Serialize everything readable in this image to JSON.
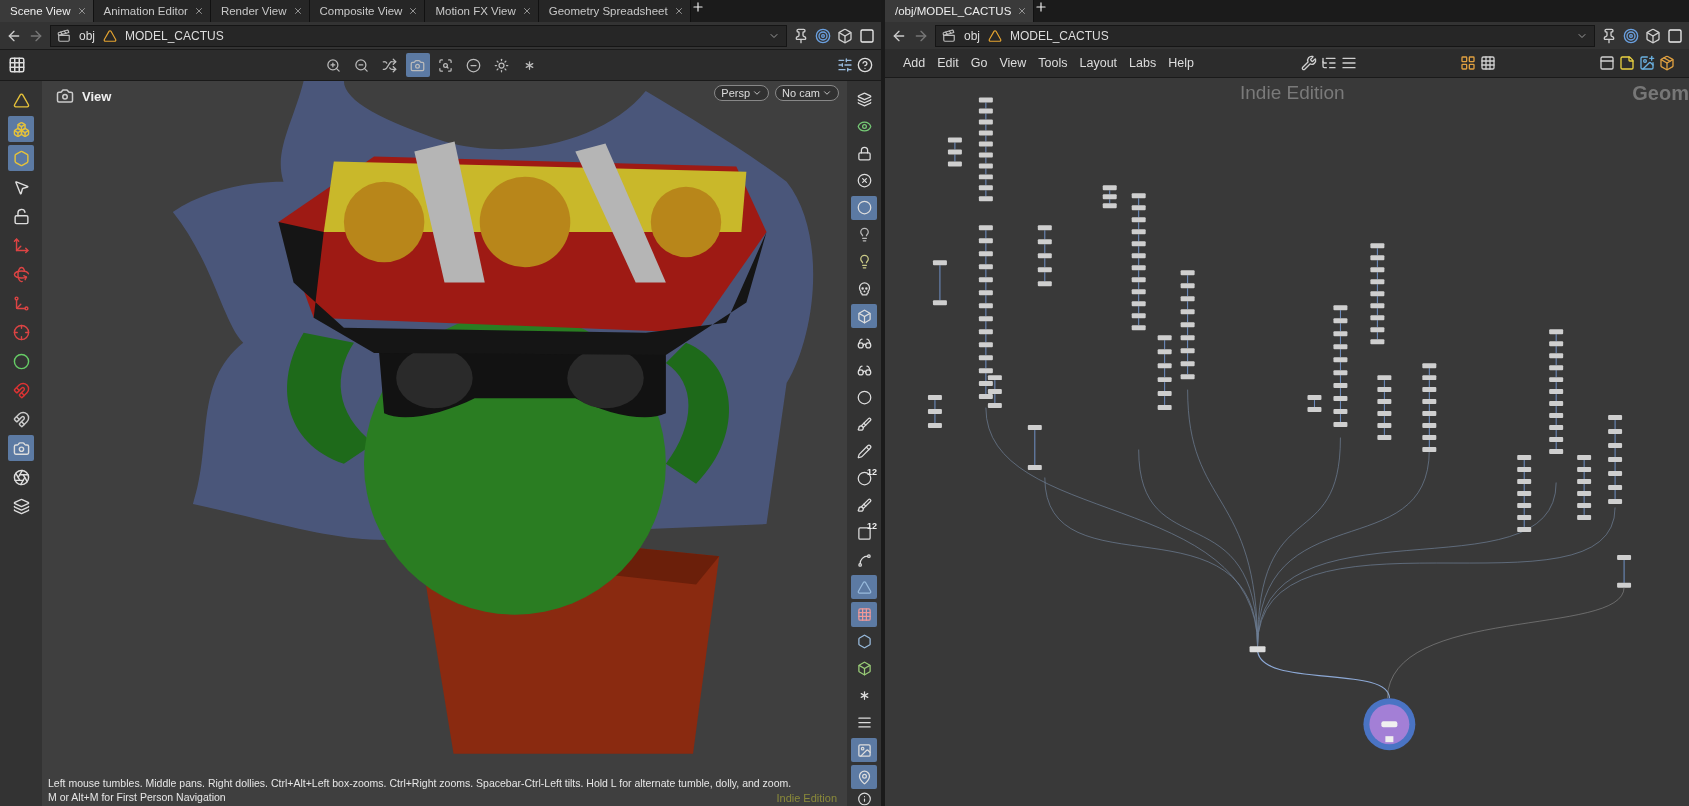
{
  "left_pane": {
    "tabs": [
      {
        "label": "Scene View",
        "selected": true
      },
      {
        "label": "Animation Editor",
        "selected": false
      },
      {
        "label": "Render View",
        "selected": false
      },
      {
        "label": "Composite View",
        "selected": false
      },
      {
        "label": "Motion FX View",
        "selected": false
      },
      {
        "label": "Geometry Spreadsheet",
        "selected": false
      }
    ],
    "path": [
      "obj",
      "MODEL_CACTUS"
    ],
    "view_tools": [
      {
        "selected": false
      },
      {
        "selected": false
      },
      {
        "selected": false
      },
      {
        "selected": true
      },
      {
        "selected": false
      },
      {
        "selected": false
      },
      {
        "selected": false
      },
      {
        "selected": false
      }
    ],
    "left_tools": [
      {
        "selected": false
      },
      {
        "selected": true
      },
      {
        "selected": true
      },
      {
        "selected": false
      },
      {
        "selected": false
      },
      {
        "selected": false
      },
      {
        "selected": false
      },
      {
        "selected": false
      },
      {
        "selected": false
      },
      {
        "selected": false
      },
      {
        "selected": false
      },
      {
        "selected": false
      },
      {
        "selected": true
      },
      {
        "selected": false
      },
      {
        "selected": false
      }
    ],
    "right_tools": [
      {
        "selected": false
      },
      {
        "selected": false
      },
      {
        "selected": false
      },
      {
        "selected": false
      },
      {
        "selected": true
      },
      {
        "selected": false
      },
      {
        "selected": false
      },
      {
        "selected": false
      },
      {
        "selected": true
      },
      {
        "selected": false
      },
      {
        "selected": false
      },
      {
        "selected": false
      },
      {
        "selected": false
      },
      {
        "selected": false
      },
      {
        "selected": false,
        "label": "12"
      },
      {
        "selected": false
      },
      {
        "selected": false,
        "label": "12"
      },
      {
        "selected": false
      },
      {
        "selected": true
      },
      {
        "selected": true
      },
      {
        "selected": false
      },
      {
        "selected": false
      },
      {
        "selected": false
      },
      {
        "selected": false
      },
      {
        "selected": true
      },
      {
        "selected": true
      }
    ],
    "viewport": {
      "title": "View",
      "projection": "Persp",
      "camera": "No cam",
      "help": [
        "Left mouse tumbles. Middle pans. Right dollies. Ctrl+Alt+Left box-zooms. Ctrl+Right zooms. Spacebar-Ctrl-Left tilts. Hold L for alternate tumble, dolly, and zoom.",
        "M or Alt+M for First Person Navigation"
      ],
      "edition": "Indie Edition"
    }
  },
  "right_pane": {
    "tabs": [
      {
        "label": "/obj/MODEL_CACTUS",
        "selected": true
      }
    ],
    "path": [
      "obj",
      "MODEL_CACTUS"
    ],
    "menu": [
      "Add",
      "Edit",
      "Go",
      "View",
      "Tools",
      "Layout",
      "Labs",
      "Help"
    ],
    "network": {
      "edition": "Indie Edition",
      "context_label": "Geom"
    }
  }
}
